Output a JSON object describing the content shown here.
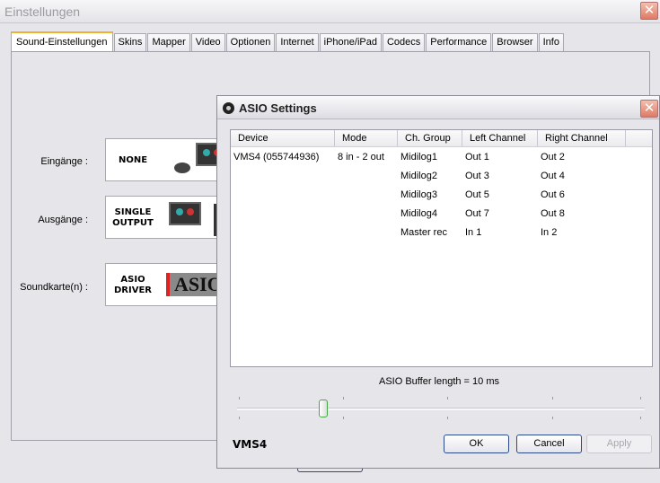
{
  "window": {
    "title": "Einstellungen"
  },
  "tabs": [
    "Sound-Einstellungen",
    "Skins",
    "Mapper",
    "Video",
    "Optionen",
    "Internet",
    "iPhone/iPad",
    "Codecs",
    "Performance",
    "Browser",
    "Info"
  ],
  "sound": {
    "inputs_label": "Eingänge :",
    "inputs_value": "NONE",
    "outputs_label": "Ausgänge :",
    "outputs_value_1": "SINGLE",
    "outputs_value_2": "OUTPUT",
    "card_label": "Soundkarte(n) :",
    "card_value_1": "ASIO",
    "card_value_2": "DRIVER",
    "card_logo": "ASIO"
  },
  "asio": {
    "title": "ASIO Settings",
    "columns": [
      "Device",
      "Mode",
      "Ch. Group",
      "Left Channel",
      "Right Channel"
    ],
    "rows": [
      [
        "VMS4 (055744936)",
        "8 in - 2 out",
        "Midilog1",
        "Out 1",
        "Out 2"
      ],
      [
        "",
        "",
        "Midilog2",
        "Out 3",
        "Out 4"
      ],
      [
        "",
        "",
        "Midilog3",
        "Out 5",
        "Out 6"
      ],
      [
        "",
        "",
        "Midilog4",
        "Out 7",
        "Out 8"
      ],
      [
        "",
        "",
        "Master rec",
        "In 1",
        "In 2"
      ]
    ],
    "buffer_label": "ASIO Buffer length = 10 ms",
    "slider_fraction": 0.21,
    "brand": "VMS4",
    "ok": "OK",
    "cancel": "Cancel",
    "apply": "Apply"
  }
}
